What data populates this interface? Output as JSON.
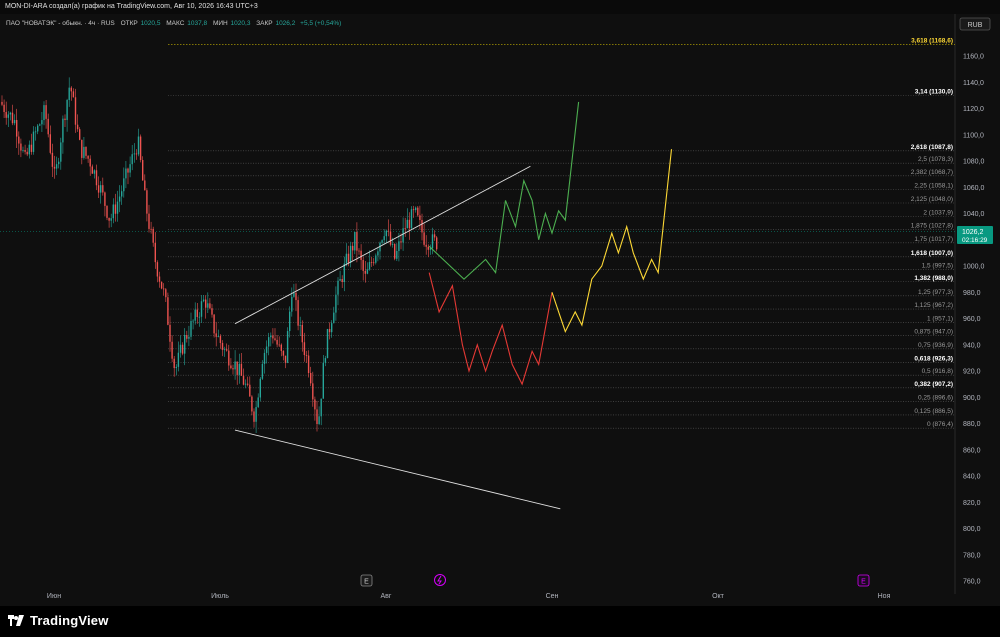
{
  "header": {
    "title": "MON-DI-ARA создал(а) график на TradingView.com, Авг 10, 2026 16:43 UTC+3"
  },
  "symbol_bar": {
    "name": "ПАО \"НОВАТЭК\" - обыкн. · 4ч · RUS",
    "open_label": "ОТКР",
    "open": "1020,5",
    "high_label": "МАКС",
    "high": "1037,8",
    "low_label": "МИН",
    "low": "1020,3",
    "close_label": "ЗАКР",
    "close": "1026,2",
    "change": "+5,5 (+0,54%)"
  },
  "currency_button": "RUB",
  "price_badge": {
    "price": "1026,2",
    "timer": "02:16:29"
  },
  "bottom_buttons": {
    "e_left": "E",
    "e_right": "E"
  },
  "brand": "TradingView",
  "colors": {
    "background": "#0f0f0f",
    "candle_up": "#26a69a",
    "candle_down": "#ef5350",
    "path_green": "#4caf50",
    "path_red": "#e53935",
    "path_yellow": "#fdd835",
    "fib_level_line": "#6a6a6a",
    "trendline": "#e0e0e0"
  },
  "chart_data": {
    "type": "candlestick",
    "interval": "4ч",
    "x_ticks": [
      "Июн",
      "Июль",
      "Авг",
      "Сен",
      "Окт",
      "Ноя"
    ],
    "y_ticks": [
      760,
      780,
      800,
      820,
      840,
      860,
      880,
      900,
      920,
      940,
      960,
      980,
      1000,
      1020,
      1040,
      1060,
      1080,
      1100,
      1120,
      1140,
      1160
    ],
    "y_tick_labels": [
      "760,0",
      "780,0",
      "800,0",
      "820,0",
      "840,0",
      "860,0",
      "880,0",
      "900,0",
      "920,0",
      "940,0",
      "960,0",
      "980,0",
      "1000,0",
      "1020,0",
      "1040,0",
      "1060,0",
      "1080,0",
      "1100,0",
      "1120,0",
      "1140,0",
      "1160,0"
    ],
    "ylim": [
      756,
      1174
    ],
    "last_price": 1026.2,
    "fib_levels": [
      {
        "label": "3,618 (1168,6)",
        "value": 1168.6,
        "highlight": "yellow"
      },
      {
        "label": "3,14 (1130,0)",
        "value": 1130.0,
        "highlight": "bold"
      },
      {
        "label": "2,618 (1087,8)",
        "value": 1087.8,
        "highlight": "bold"
      },
      {
        "label": "2,5 (1078,3)",
        "value": 1078.3
      },
      {
        "label": "2,382 (1068,7)",
        "value": 1068.7
      },
      {
        "label": "2,25 (1058,1)",
        "value": 1058.1
      },
      {
        "label": "2,125 (1048,0)",
        "value": 1048.0
      },
      {
        "label": "2 (1037,9)",
        "value": 1037.9
      },
      {
        "label": "1,875 (1027,8)",
        "value": 1027.8
      },
      {
        "label": "1,75 (1017,7)",
        "value": 1017.7
      },
      {
        "label": "1,618 (1007,0)",
        "value": 1007.0,
        "highlight": "bold"
      },
      {
        "label": "1,5 (997,5)",
        "value": 997.5
      },
      {
        "label": "1,382 (988,0)",
        "value": 988.0,
        "highlight": "bold"
      },
      {
        "label": "1,25 (977,3)",
        "value": 977.3
      },
      {
        "label": "1,125 (967,2)",
        "value": 967.2
      },
      {
        "label": "1 (957,1)",
        "value": 957.1
      },
      {
        "label": "0,875 (947,0)",
        "value": 947.0
      },
      {
        "label": "0,75 (936,9)",
        "value": 936.9
      },
      {
        "label": "0,618 (926,3)",
        "value": 926.3,
        "highlight": "bold"
      },
      {
        "label": "0,5 (916,8)",
        "value": 916.8
      },
      {
        "label": "0,382 (907,2)",
        "value": 907.2,
        "highlight": "bold"
      },
      {
        "label": "0,25 (896,6)",
        "value": 896.6
      },
      {
        "label": "0,125 (886,5)",
        "value": 886.5
      },
      {
        "label": "0 (876,4)",
        "value": 876.4
      }
    ],
    "projection_paths": [
      {
        "color": "green",
        "points": [
          [
            1026,
            1015
          ],
          [
            1047,
            990
          ],
          [
            1060,
            1005
          ],
          [
            1066,
            995
          ],
          [
            1072,
            1050
          ],
          [
            1078,
            1030
          ],
          [
            1083,
            1065
          ],
          [
            1088,
            1050
          ],
          [
            1092,
            1020
          ],
          [
            1096,
            1040
          ],
          [
            1100,
            1025
          ],
          [
            1104,
            1042
          ],
          [
            1108,
            1035
          ],
          [
            1116,
            1125
          ]
        ]
      },
      {
        "color": "red",
        "points": [
          [
            1026,
            995
          ],
          [
            1032,
            965
          ],
          [
            1040,
            985
          ],
          [
            1046,
            940
          ],
          [
            1050,
            920
          ],
          [
            1055,
            940
          ],
          [
            1060,
            920
          ],
          [
            1064,
            935
          ],
          [
            1070,
            955
          ],
          [
            1076,
            925
          ],
          [
            1082,
            910
          ],
          [
            1088,
            935
          ],
          [
            1092,
            925
          ],
          [
            1100,
            980
          ]
        ]
      },
      {
        "color": "yellow",
        "points": [
          [
            1100,
            980
          ],
          [
            1108,
            950
          ],
          [
            1114,
            965
          ],
          [
            1118,
            955
          ],
          [
            1124,
            990
          ],
          [
            1130,
            1000
          ],
          [
            1136,
            1025
          ],
          [
            1140,
            1010
          ],
          [
            1145,
            1030
          ],
          [
            1149,
            1010
          ],
          [
            1155,
            990
          ],
          [
            1160,
            1005
          ],
          [
            1164,
            995
          ],
          [
            1172,
            1089
          ]
        ]
      }
    ],
    "trendlines": [
      {
        "from": [
          909,
          956
        ],
        "to": [
          1087,
          1076
        ]
      },
      {
        "from": [
          909,
          875
        ],
        "to": [
          1105,
          815
        ]
      }
    ]
  }
}
